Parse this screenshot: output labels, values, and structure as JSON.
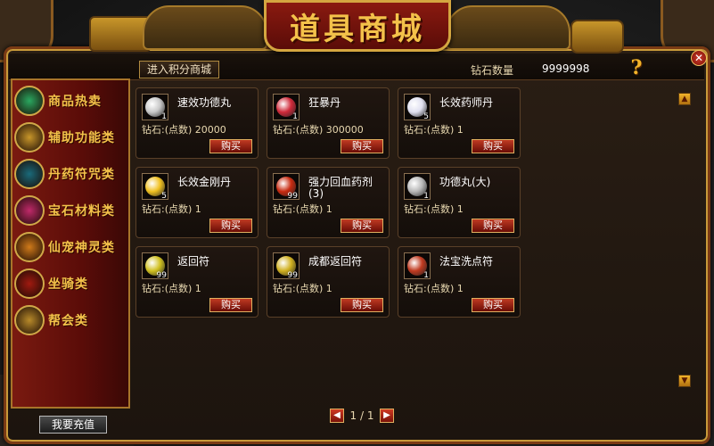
{
  "window": {
    "title": "道具商城"
  },
  "header": {
    "points_mall_button": "进入积分商城",
    "diamond_label": "钻石数量",
    "diamond_value": "9999998"
  },
  "sidebar": {
    "items": [
      {
        "label": "商品热卖",
        "icon": "book-icon",
        "color": "#2aa860"
      },
      {
        "label": "辅助功能类",
        "icon": "scroll-icon",
        "color": "#c8962a"
      },
      {
        "label": "丹药符咒类",
        "icon": "orb-icon",
        "color": "#1a6a7a"
      },
      {
        "label": "宝石材料类",
        "icon": "gem-icon",
        "color": "#c02a6a"
      },
      {
        "label": "仙宠神灵类",
        "icon": "pet-icon",
        "color": "#d07a1a"
      },
      {
        "label": "坐骑类",
        "icon": "mount-icon",
        "color": "#a01a10"
      },
      {
        "label": "帮会类",
        "icon": "guild-icon",
        "color": "#b88a2a"
      }
    ],
    "recharge_button": "我要充值"
  },
  "items": [
    {
      "name": "速效功德丸",
      "price": "钻石:(点数) 20000",
      "qty": "1",
      "icon_color": "#c8c8c8",
      "buy": "购买"
    },
    {
      "name": "狂暴丹",
      "price": "钻石:(点数) 300000",
      "qty": "1",
      "icon_color": "#d02a3a",
      "buy": "购买"
    },
    {
      "name": "长效药师丹",
      "price": "钻石:(点数) 1",
      "qty": "5",
      "icon_color": "#e0e0f0",
      "buy": "购买"
    },
    {
      "name": "长效金刚丹",
      "price": "钻石:(点数) 1",
      "qty": "5",
      "icon_color": "#f0c020",
      "buy": "购买"
    },
    {
      "name": "强力回血药剂(3)",
      "price": "钻石:(点数) 1",
      "qty": "99",
      "icon_color": "#c82a10",
      "buy": "购买"
    },
    {
      "name": "功德丸(大)",
      "price": "钻石:(点数) 1",
      "qty": "1",
      "icon_color": "#b8b8b8",
      "buy": "购买"
    },
    {
      "name": "返回符",
      "price": "钻石:(点数) 1",
      "qty": "99",
      "icon_color": "#d0c020",
      "buy": "购买"
    },
    {
      "name": "成都返回符",
      "price": "钻石:(点数) 1",
      "qty": "99",
      "icon_color": "#d0b020",
      "buy": "购买"
    },
    {
      "name": "法宝洗点符",
      "price": "钻石:(点数) 1",
      "qty": "1",
      "icon_color": "#c03a20",
      "buy": "购买"
    }
  ],
  "pagination": {
    "text": "1 / 1"
  }
}
